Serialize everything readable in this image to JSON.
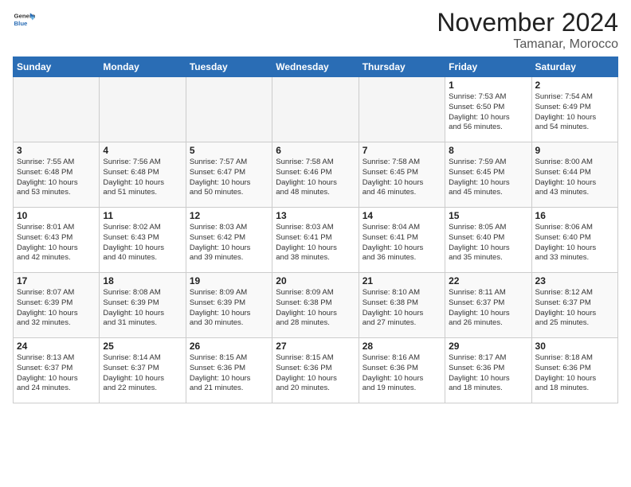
{
  "header": {
    "logo_general": "General",
    "logo_blue": "Blue",
    "month_title": "November 2024",
    "subtitle": "Tamanar, Morocco"
  },
  "days_of_week": [
    "Sunday",
    "Monday",
    "Tuesday",
    "Wednesday",
    "Thursday",
    "Friday",
    "Saturday"
  ],
  "weeks": [
    [
      {
        "day": "",
        "info": ""
      },
      {
        "day": "",
        "info": ""
      },
      {
        "day": "",
        "info": ""
      },
      {
        "day": "",
        "info": ""
      },
      {
        "day": "",
        "info": ""
      },
      {
        "day": "1",
        "info": "Sunrise: 7:53 AM\nSunset: 6:50 PM\nDaylight: 10 hours\nand 56 minutes."
      },
      {
        "day": "2",
        "info": "Sunrise: 7:54 AM\nSunset: 6:49 PM\nDaylight: 10 hours\nand 54 minutes."
      }
    ],
    [
      {
        "day": "3",
        "info": "Sunrise: 7:55 AM\nSunset: 6:48 PM\nDaylight: 10 hours\nand 53 minutes."
      },
      {
        "day": "4",
        "info": "Sunrise: 7:56 AM\nSunset: 6:48 PM\nDaylight: 10 hours\nand 51 minutes."
      },
      {
        "day": "5",
        "info": "Sunrise: 7:57 AM\nSunset: 6:47 PM\nDaylight: 10 hours\nand 50 minutes."
      },
      {
        "day": "6",
        "info": "Sunrise: 7:58 AM\nSunset: 6:46 PM\nDaylight: 10 hours\nand 48 minutes."
      },
      {
        "day": "7",
        "info": "Sunrise: 7:58 AM\nSunset: 6:45 PM\nDaylight: 10 hours\nand 46 minutes."
      },
      {
        "day": "8",
        "info": "Sunrise: 7:59 AM\nSunset: 6:45 PM\nDaylight: 10 hours\nand 45 minutes."
      },
      {
        "day": "9",
        "info": "Sunrise: 8:00 AM\nSunset: 6:44 PM\nDaylight: 10 hours\nand 43 minutes."
      }
    ],
    [
      {
        "day": "10",
        "info": "Sunrise: 8:01 AM\nSunset: 6:43 PM\nDaylight: 10 hours\nand 42 minutes."
      },
      {
        "day": "11",
        "info": "Sunrise: 8:02 AM\nSunset: 6:43 PM\nDaylight: 10 hours\nand 40 minutes."
      },
      {
        "day": "12",
        "info": "Sunrise: 8:03 AM\nSunset: 6:42 PM\nDaylight: 10 hours\nand 39 minutes."
      },
      {
        "day": "13",
        "info": "Sunrise: 8:03 AM\nSunset: 6:41 PM\nDaylight: 10 hours\nand 38 minutes."
      },
      {
        "day": "14",
        "info": "Sunrise: 8:04 AM\nSunset: 6:41 PM\nDaylight: 10 hours\nand 36 minutes."
      },
      {
        "day": "15",
        "info": "Sunrise: 8:05 AM\nSunset: 6:40 PM\nDaylight: 10 hours\nand 35 minutes."
      },
      {
        "day": "16",
        "info": "Sunrise: 8:06 AM\nSunset: 6:40 PM\nDaylight: 10 hours\nand 33 minutes."
      }
    ],
    [
      {
        "day": "17",
        "info": "Sunrise: 8:07 AM\nSunset: 6:39 PM\nDaylight: 10 hours\nand 32 minutes."
      },
      {
        "day": "18",
        "info": "Sunrise: 8:08 AM\nSunset: 6:39 PM\nDaylight: 10 hours\nand 31 minutes."
      },
      {
        "day": "19",
        "info": "Sunrise: 8:09 AM\nSunset: 6:39 PM\nDaylight: 10 hours\nand 30 minutes."
      },
      {
        "day": "20",
        "info": "Sunrise: 8:09 AM\nSunset: 6:38 PM\nDaylight: 10 hours\nand 28 minutes."
      },
      {
        "day": "21",
        "info": "Sunrise: 8:10 AM\nSunset: 6:38 PM\nDaylight: 10 hours\nand 27 minutes."
      },
      {
        "day": "22",
        "info": "Sunrise: 8:11 AM\nSunset: 6:37 PM\nDaylight: 10 hours\nand 26 minutes."
      },
      {
        "day": "23",
        "info": "Sunrise: 8:12 AM\nSunset: 6:37 PM\nDaylight: 10 hours\nand 25 minutes."
      }
    ],
    [
      {
        "day": "24",
        "info": "Sunrise: 8:13 AM\nSunset: 6:37 PM\nDaylight: 10 hours\nand 24 minutes."
      },
      {
        "day": "25",
        "info": "Sunrise: 8:14 AM\nSunset: 6:37 PM\nDaylight: 10 hours\nand 22 minutes."
      },
      {
        "day": "26",
        "info": "Sunrise: 8:15 AM\nSunset: 6:36 PM\nDaylight: 10 hours\nand 21 minutes."
      },
      {
        "day": "27",
        "info": "Sunrise: 8:15 AM\nSunset: 6:36 PM\nDaylight: 10 hours\nand 20 minutes."
      },
      {
        "day": "28",
        "info": "Sunrise: 8:16 AM\nSunset: 6:36 PM\nDaylight: 10 hours\nand 19 minutes."
      },
      {
        "day": "29",
        "info": "Sunrise: 8:17 AM\nSunset: 6:36 PM\nDaylight: 10 hours\nand 18 minutes."
      },
      {
        "day": "30",
        "info": "Sunrise: 8:18 AM\nSunset: 6:36 PM\nDaylight: 10 hours\nand 18 minutes."
      }
    ]
  ]
}
